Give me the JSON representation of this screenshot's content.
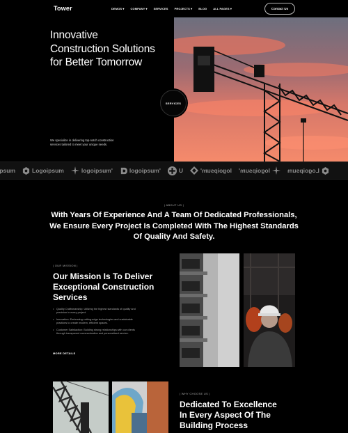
{
  "header": {
    "logo": "Tower",
    "nav": [
      {
        "label": "DEMOS",
        "caret": true
      },
      {
        "label": "COMPANY",
        "caret": true
      },
      {
        "label": "SERVICES",
        "caret": false
      },
      {
        "label": "PROJECTS",
        "caret": true
      },
      {
        "label": "BLOG",
        "caret": false
      },
      {
        "label": "ALL PAGES",
        "caret": true
      }
    ],
    "contact_label": "Contact Us"
  },
  "hero": {
    "title_lines": [
      "Innovative",
      "Construction Solutions",
      "for Better Tomorrow"
    ],
    "subtitle_lines": [
      "We specialize in delivering top-notch construction",
      "services tailored to meet your unique needs."
    ],
    "badge_label": "SERVICES"
  },
  "logo_strip": {
    "items": [
      {
        "text": "ipsum",
        "icon": "circle-icon",
        "mirrored": false
      },
      {
        "text": "Logoipsum",
        "icon": "hexagon-icon",
        "mirrored": false
      },
      {
        "text": "logoipsum'",
        "icon": "star-icon",
        "mirrored": false
      },
      {
        "text": "logoipsum'",
        "icon": "bracket-icon",
        "mirrored": false
      },
      {
        "text": "U",
        "icon": "plus-circle-icon",
        "mirrored": false
      },
      {
        "text": "logoipsum'",
        "icon": "diamond-icon",
        "mirrored": true
      },
      {
        "text": "logoipsum'",
        "icon": "star-icon",
        "mirrored": true
      },
      {
        "text": "Logoipsum",
        "icon": "hexagon-icon",
        "mirrored": true
      }
    ]
  },
  "about": {
    "pill": "| ABOUT US |",
    "text_lines": [
      "With Years Of Experience And A Team Of Dedicated Professionals,",
      "We Ensure Every Project Is Completed With The Highest Standards",
      "Of Quality And Safety."
    ]
  },
  "mission": {
    "pill": "| OUR MISSION |",
    "title_lines": [
      "Our Mission Is To Deliver",
      "Exceptional Construction",
      "Services"
    ],
    "bullets": [
      "Quality Craftsmanship: Utilizing the highest standards of quality and precision in every project.",
      "Innovation: Embracing cutting-edge technologies and sustainable practices to create modern, efficient spaces.",
      "Customer Satisfaction: Building strong relationships with our clients through transparent communication and personalized service."
    ],
    "more_label": "MORE DETAILS"
  },
  "why": {
    "pill": "| WHY CHOOSE US |",
    "title_lines": [
      "Dedicated To Excellence",
      "In Every Aspect Of The",
      "Building Process"
    ]
  },
  "colors": {
    "background": "#000000",
    "sky_orange": "#ff7a5a",
    "strip_bg": "#111111",
    "muted_text": "#aaaaaa"
  }
}
